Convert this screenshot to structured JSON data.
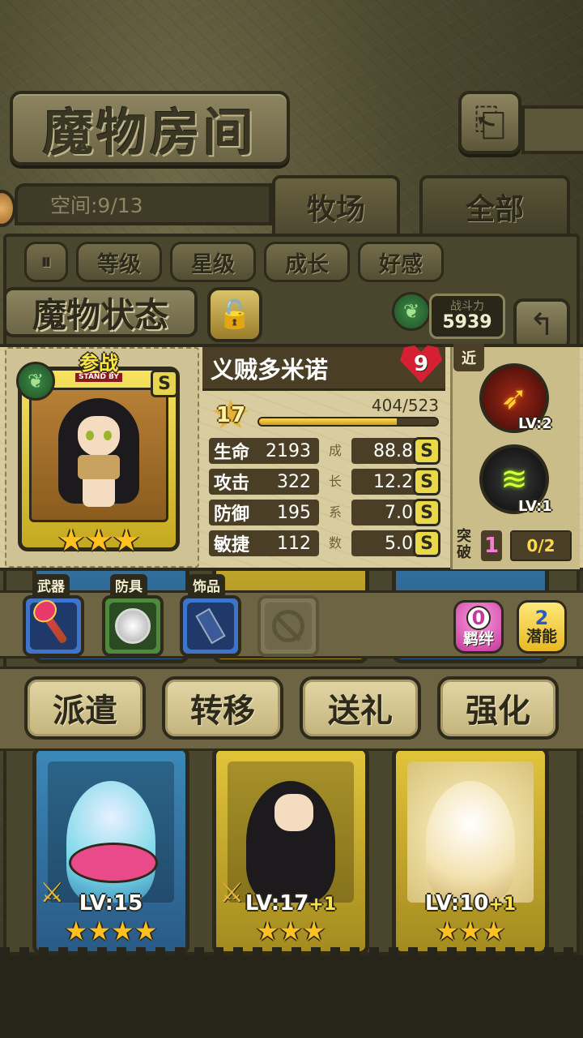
{
  "header": {
    "title": "魔物房间",
    "back_icon": "return-arrow"
  },
  "tabs": {
    "space_label": "空间:9/13",
    "ranch": "牧场",
    "all": "全部"
  },
  "sort": {
    "items": [
      "等级",
      "星级",
      "成长",
      "好感"
    ]
  },
  "status": {
    "title": "魔物状态",
    "power_label": "战斗力",
    "power_value": "5939",
    "standby_cn": "参战",
    "standby_en": "STAND BY",
    "rank": "S",
    "stars": "★★★",
    "name": "义贼多米诺",
    "affinity": "9",
    "level": "17",
    "exp_text": "404/523",
    "exp_fraction": 0.772,
    "range_tag": "近",
    "stats": [
      {
        "label": "生命",
        "value": "2193",
        "growth_char": "成",
        "growth": "88.8",
        "grade": "S"
      },
      {
        "label": "攻击",
        "value": "322",
        "growth_char": "长",
        "growth": "12.2",
        "grade": "S"
      },
      {
        "label": "防御",
        "value": "195",
        "growth_char": "系",
        "growth": "7.0",
        "grade": "S"
      },
      {
        "label": "敏捷",
        "value": "112",
        "growth_char": "数",
        "growth": "5.0",
        "grade": "S"
      }
    ],
    "skills": [
      {
        "icon": "crossbow-skill-icon",
        "lv": "LV:2"
      },
      {
        "icon": "lightning-skill-icon",
        "lv": "LV:1"
      }
    ],
    "breakthrough_label": "突破",
    "breakthrough_value": "1",
    "breakthrough_count": "0/2"
  },
  "equipment": {
    "weapon_label": "武器",
    "armor_label": "防具",
    "accessory_label": "饰品",
    "bond_num": "0",
    "bond_label": "羁绊",
    "potential_num": "2",
    "potential_label": "潜能"
  },
  "actions": {
    "dispatch": "派遣",
    "transfer": "转移",
    "gift": "送礼",
    "enhance": "强化"
  },
  "grid_cards": [
    {
      "lv": "LV:15",
      "plus": "",
      "stars": "★★★★",
      "color": "#3b88b8"
    },
    {
      "lv": "LV:17",
      "plus": "+1",
      "stars": "★★★",
      "color": "#e2c43a"
    },
    {
      "lv": "LV:10",
      "plus": "+1",
      "stars": "★★★",
      "color": "#e2c43a"
    }
  ],
  "colors": {
    "panel_bg": "#d9cda0",
    "dark_outline": "#2d2a1b",
    "exp_fill": "#d69b14",
    "grade_badge": "#e8d84a"
  }
}
